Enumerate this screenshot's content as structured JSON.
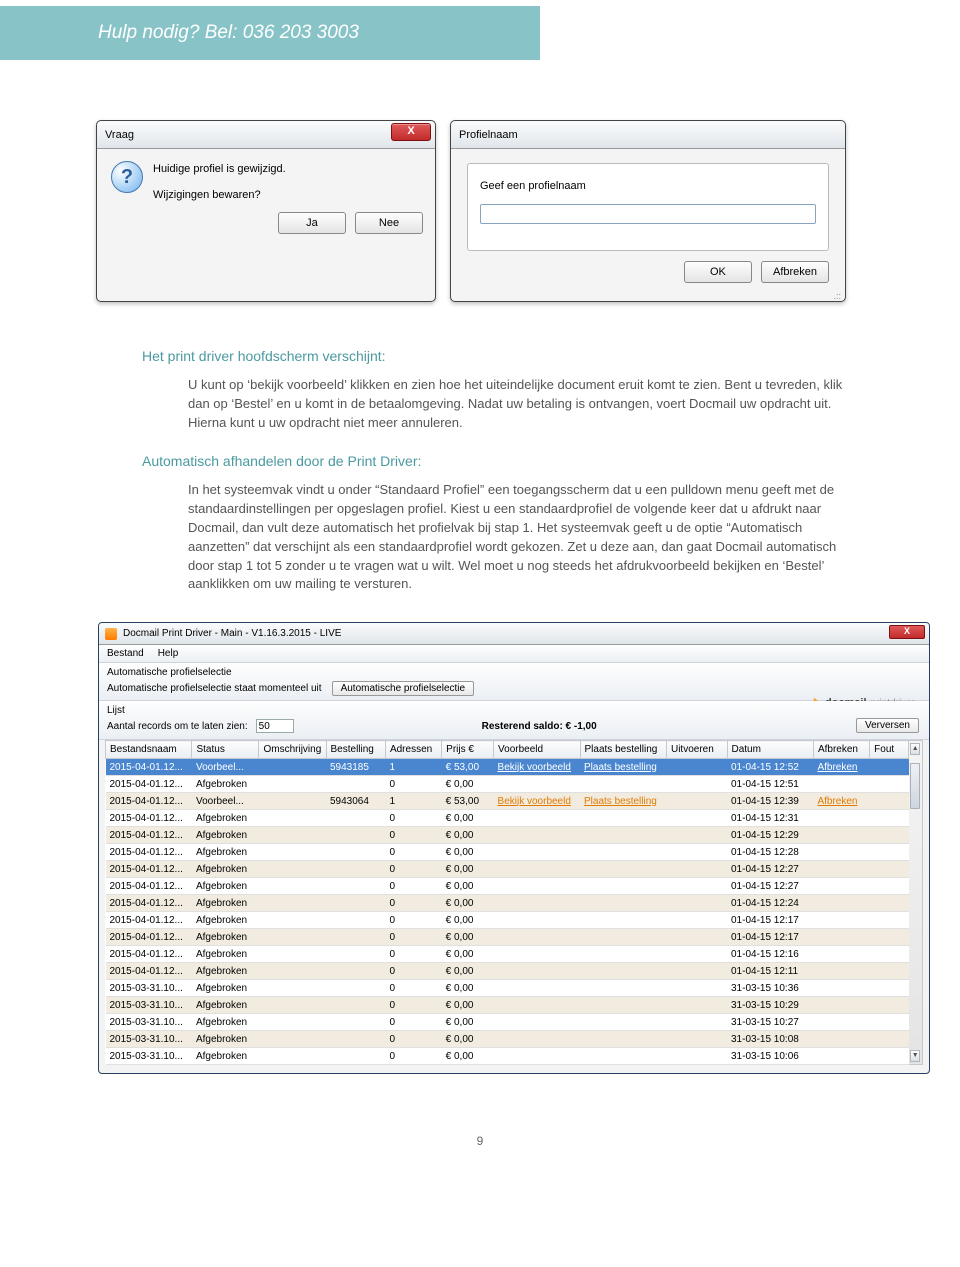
{
  "header": {
    "help_text": "Hulp nodig? Bel: 036 203 3003"
  },
  "vraag_dialog": {
    "title": "Vraag",
    "line1": "Huidige profiel is gewijzigd.",
    "line2": "Wijzigingen bewaren?",
    "btn_yes": "Ja",
    "btn_no": "Nee"
  },
  "profiel_dialog": {
    "title": "Profielnaam",
    "prompt": "Geef een profielnaam",
    "value": "",
    "btn_ok": "OK",
    "btn_cancel": "Afbreken"
  },
  "doc": {
    "h1": "Het print driver hoofdscherm verschijnt:",
    "p1": "U kunt op ‘bekijk voorbeeld’ klikken en zien hoe het uiteindelijke document eruit komt te zien. Bent u tevreden, klik dan op ‘Bestel’ en u komt in de betaalomgeving. Nadat uw betaling is ontvangen, voert Docmail uw opdracht uit. Hierna kunt u uw opdracht niet meer annuleren.",
    "h2": "Automatisch afhandelen door de Print Driver:",
    "p2": "In het systeemvak vindt u onder “Standaard Profiel” een toegangsscherm dat u een pulldown menu geeft met de standaardinstellingen per opgeslagen profiel. Kiest u een standaardprofiel de volgende keer dat u afdrukt naar Docmail, dan vult deze automatisch het profielvak bij stap 1. Het systeemvak geeft u de optie “Automatisch aanzetten” dat verschijnt als een standaardprofiel wordt gekozen. Zet u deze aan, dan gaat Docmail automatisch door stap 1 tot 5 zonder u te vragen wat u wilt. Wel moet u nog steeds het afdrukvoorbeeld bekijken en ‘Bestel’ aanklikken om uw mailing te versturen."
  },
  "driver": {
    "title": "Docmail Print Driver - Main - V1.16.3.2015 - LIVE",
    "menu_bestand": "Bestand",
    "menu_help": "Help",
    "auto_section_title": "Automatische profielselectie",
    "auto_status": "Automatische profielselectie staat momenteel uit",
    "auto_button": "Automatische profielselectie",
    "logo_text1": "docmail",
    "logo_text2": "printdriver",
    "lijst_title": "Lijst",
    "records_label": "Aantal records om te laten zien:",
    "records_value": "50",
    "saldo_label": "Resterend saldo:  € -1,00",
    "refresh": "Verversen",
    "columns": [
      "Bestandsnaam",
      "Status",
      "Omschrijving",
      "Bestelling",
      "Adressen",
      "Prijs €",
      "Voorbeeld",
      "Plaats bestelling",
      "Uitvoeren",
      "Datum",
      "Afbreken",
      "Fout"
    ],
    "link_voorbeeld": "Bekijk voorbeeld",
    "link_plaats": "Plaats bestelling",
    "link_afbreken": "Afbreken",
    "rows": [
      {
        "bestand": "2015-04-01.12...",
        "status": "Voorbeel...",
        "bestelling": "5943185",
        "adr": "1",
        "prijs": "€ 53,00",
        "links": true,
        "datum": "01-04-15 12:52",
        "afbreken": true
      },
      {
        "bestand": "2015-04-01.12...",
        "status": "Afgebroken",
        "bestelling": "",
        "adr": "0",
        "prijs": "€ 0,00",
        "links": false,
        "datum": "01-04-15 12:51",
        "afbreken": false
      },
      {
        "bestand": "2015-04-01.12...",
        "status": "Voorbeel...",
        "bestelling": "5943064",
        "adr": "1",
        "prijs": "€ 53,00",
        "links": true,
        "datum": "01-04-15 12:39",
        "afbreken": true
      },
      {
        "bestand": "2015-04-01.12...",
        "status": "Afgebroken",
        "bestelling": "",
        "adr": "0",
        "prijs": "€ 0,00",
        "links": false,
        "datum": "01-04-15 12:31",
        "afbreken": false
      },
      {
        "bestand": "2015-04-01.12...",
        "status": "Afgebroken",
        "bestelling": "",
        "adr": "0",
        "prijs": "€ 0,00",
        "links": false,
        "datum": "01-04-15 12:29",
        "afbreken": false
      },
      {
        "bestand": "2015-04-01.12...",
        "status": "Afgebroken",
        "bestelling": "",
        "adr": "0",
        "prijs": "€ 0,00",
        "links": false,
        "datum": "01-04-15 12:28",
        "afbreken": false
      },
      {
        "bestand": "2015-04-01.12...",
        "status": "Afgebroken",
        "bestelling": "",
        "adr": "0",
        "prijs": "€ 0,00",
        "links": false,
        "datum": "01-04-15 12:27",
        "afbreken": false
      },
      {
        "bestand": "2015-04-01.12...",
        "status": "Afgebroken",
        "bestelling": "",
        "adr": "0",
        "prijs": "€ 0,00",
        "links": false,
        "datum": "01-04-15 12:27",
        "afbreken": false
      },
      {
        "bestand": "2015-04-01.12...",
        "status": "Afgebroken",
        "bestelling": "",
        "adr": "0",
        "prijs": "€ 0,00",
        "links": false,
        "datum": "01-04-15 12:24",
        "afbreken": false
      },
      {
        "bestand": "2015-04-01.12...",
        "status": "Afgebroken",
        "bestelling": "",
        "adr": "0",
        "prijs": "€ 0,00",
        "links": false,
        "datum": "01-04-15 12:17",
        "afbreken": false
      },
      {
        "bestand": "2015-04-01.12...",
        "status": "Afgebroken",
        "bestelling": "",
        "adr": "0",
        "prijs": "€ 0,00",
        "links": false,
        "datum": "01-04-15 12:17",
        "afbreken": false
      },
      {
        "bestand": "2015-04-01.12...",
        "status": "Afgebroken",
        "bestelling": "",
        "adr": "0",
        "prijs": "€ 0,00",
        "links": false,
        "datum": "01-04-15 12:16",
        "afbreken": false
      },
      {
        "bestand": "2015-04-01.12...",
        "status": "Afgebroken",
        "bestelling": "",
        "adr": "0",
        "prijs": "€ 0,00",
        "links": false,
        "datum": "01-04-15 12:11",
        "afbreken": false
      },
      {
        "bestand": "2015-03-31.10...",
        "status": "Afgebroken",
        "bestelling": "",
        "adr": "0",
        "prijs": "€ 0,00",
        "links": false,
        "datum": "31-03-15 10:36",
        "afbreken": false
      },
      {
        "bestand": "2015-03-31.10...",
        "status": "Afgebroken",
        "bestelling": "",
        "adr": "0",
        "prijs": "€ 0,00",
        "links": false,
        "datum": "31-03-15 10:29",
        "afbreken": false
      },
      {
        "bestand": "2015-03-31.10...",
        "status": "Afgebroken",
        "bestelling": "",
        "adr": "0",
        "prijs": "€ 0,00",
        "links": false,
        "datum": "31-03-15 10:27",
        "afbreken": false
      },
      {
        "bestand": "2015-03-31.10...",
        "status": "Afgebroken",
        "bestelling": "",
        "adr": "0",
        "prijs": "€ 0,00",
        "links": false,
        "datum": "31-03-15 10:08",
        "afbreken": false
      },
      {
        "bestand": "2015-03-31.10...",
        "status": "Afgebroken",
        "bestelling": "",
        "adr": "0",
        "prijs": "€ 0,00",
        "links": false,
        "datum": "31-03-15 10:06",
        "afbreken": false
      }
    ]
  },
  "page_number": "9"
}
